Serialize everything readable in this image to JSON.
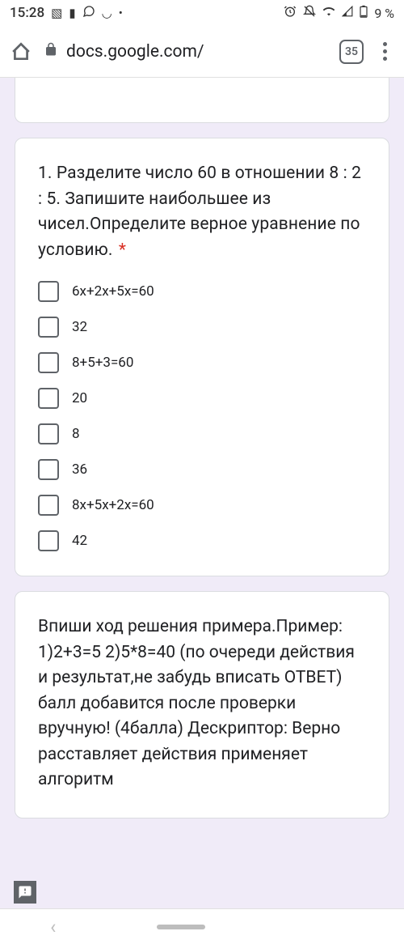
{
  "status": {
    "time": "15:28",
    "battery": "9 %"
  },
  "browser": {
    "url": "docs.google.com/",
    "tabs": "35"
  },
  "question": {
    "title": "1. Разделите число 60 в отношении 8 : 2 : 5. Запишите наибольшее из чисел.Определите верное уравнение по условию.",
    "required": "*",
    "options": [
      "6x+2x+5x=60",
      "32",
      "8+5+3=60",
      "20",
      "8",
      "36",
      "8x+5x+2x=60",
      "42"
    ]
  },
  "description": {
    "text": "Впиши ход решения примера.Пример: 1)2+3=5 2)5*8=40 (по очереди действия и результат,не забудь вписать ОТВЕТ) балл добавится после проверки вручную! (4балла) Дескриптор: Верно расставляет действия применяет алгоритм"
  }
}
